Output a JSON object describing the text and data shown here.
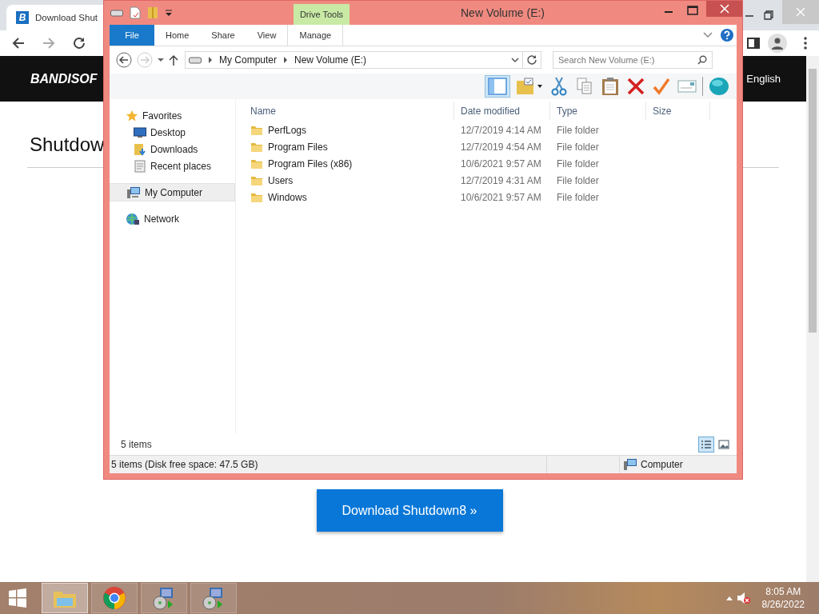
{
  "browser": {
    "tab_icon_letter": "B",
    "tab_title": "Download Shut",
    "logo": "BANDISOF",
    "language": "English",
    "heading": "Shutdow",
    "download_button": "Download Shutdown8 »"
  },
  "explorer": {
    "title": "New Volume (E:)",
    "context_group": "Drive Tools",
    "ribbon_tabs": [
      {
        "label": "File",
        "kind": "file",
        "selected": false
      },
      {
        "label": "Home",
        "kind": "tab",
        "selected": false
      },
      {
        "label": "Share",
        "kind": "tab",
        "selected": false
      },
      {
        "label": "View",
        "kind": "tab",
        "selected": false
      },
      {
        "label": "Manage",
        "kind": "context",
        "selected": false
      }
    ],
    "breadcrumbs": [
      "My Computer",
      "New Volume (E:)"
    ],
    "search": {
      "placeholder": "Search New Volume (E:)"
    },
    "toolbar": [
      {
        "kind": "pane",
        "selected": true
      },
      {
        "kind": "folder-check",
        "selected": false
      },
      {
        "kind": "scissors",
        "selected": false
      },
      {
        "kind": "copy",
        "selected": false
      },
      {
        "kind": "paste",
        "selected": false
      },
      {
        "kind": "delete",
        "selected": false
      },
      {
        "kind": "check",
        "selected": false
      },
      {
        "kind": "card",
        "selected": false
      },
      {
        "kind": "sphere",
        "selected": false
      }
    ],
    "nav": [
      {
        "label": "Favorites",
        "kind": "star",
        "selected": false,
        "children": [
          {
            "label": "Desktop",
            "kind": "desktop",
            "selected": false
          },
          {
            "label": "Downloads",
            "kind": "downloads",
            "selected": false
          },
          {
            "label": "Recent places",
            "kind": "recent",
            "selected": false
          }
        ]
      },
      {
        "label": "My Computer",
        "kind": "computer",
        "selected": true
      },
      {
        "label": "Network",
        "kind": "network",
        "selected": false
      }
    ],
    "columns": [
      "Name",
      "Date modified",
      "Type",
      "Size"
    ],
    "rows": [
      {
        "name": "PerfLogs",
        "date": "12/7/2019 4:14 AM",
        "type": "File folder"
      },
      {
        "name": "Program Files",
        "date": "12/7/2019 4:54 AM",
        "type": "File folder"
      },
      {
        "name": "Program Files (x86)",
        "date": "10/6/2021 9:57 AM",
        "type": "File folder"
      },
      {
        "name": "Users",
        "date": "12/7/2019 4:31 AM",
        "type": "File folder"
      },
      {
        "name": "Windows",
        "date": "10/6/2021 9:57 AM",
        "type": "File folder"
      }
    ],
    "item_count": "5 items",
    "views": [
      {
        "kind": "details",
        "selected": true
      },
      {
        "kind": "large",
        "selected": false
      }
    ],
    "status": "5 items (Disk free space: 47.5 GB)",
    "status_location": "Computer"
  },
  "taskbar": {
    "items": [
      {
        "kind": "explorer",
        "selected": true
      },
      {
        "kind": "chrome",
        "selected": false
      },
      {
        "kind": "setup",
        "selected": false
      },
      {
        "kind": "setup",
        "selected": false
      }
    ],
    "time": "8:05 AM",
    "date": "8/26/2022"
  }
}
